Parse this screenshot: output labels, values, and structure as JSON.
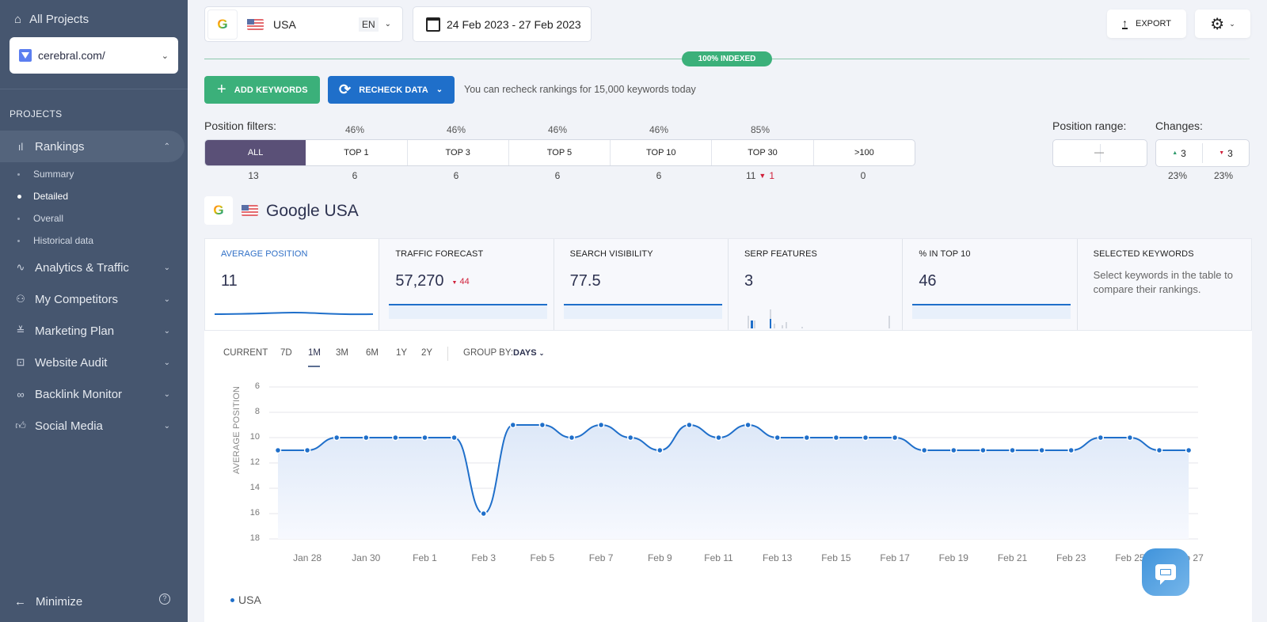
{
  "sidebar": {
    "all_projects": "All Projects",
    "project": "cerebral.com/",
    "section": "PROJECTS",
    "items": [
      {
        "label": "Rankings",
        "icon": "bar-chart-icon"
      },
      {
        "label": "Analytics & Traffic",
        "icon": "pulse-icon"
      },
      {
        "label": "My Competitors",
        "icon": "users-icon"
      },
      {
        "label": "Marketing Plan",
        "icon": "checklist-icon"
      },
      {
        "label": "Website Audit",
        "icon": "search-box-icon"
      },
      {
        "label": "Backlink Monitor",
        "icon": "link-icon"
      },
      {
        "label": "Social Media",
        "icon": "thumbs-up-icon"
      }
    ],
    "sub_items": [
      "Summary",
      "Detailed",
      "Overall",
      "Historical data"
    ],
    "minimize": "Minimize"
  },
  "header": {
    "search_engine": "G",
    "country": "USA",
    "language": "EN",
    "date_range": "24 Feb 2023 - 27 Feb 2023",
    "export": "EXPORT",
    "indexed": "100% INDEXED",
    "add_keywords": "ADD KEYWORDS",
    "recheck": "RECHECK DATA",
    "recheck_note": "You can recheck rankings for 15,000 keywords today"
  },
  "filters": {
    "label": "Position filters:",
    "segments": [
      {
        "label": "ALL",
        "pct": "",
        "count": "13"
      },
      {
        "label": "TOP 1",
        "pct": "46%",
        "count": "6"
      },
      {
        "label": "TOP 3",
        "pct": "46%",
        "count": "6"
      },
      {
        "label": "TOP 5",
        "pct": "46%",
        "count": "6"
      },
      {
        "label": "TOP 10",
        "pct": "46%",
        "count": "6"
      },
      {
        "label": "TOP 30",
        "pct": "85%",
        "count": "11",
        "change": "1"
      },
      {
        "label": ">100",
        "pct": "",
        "count": "0"
      }
    ],
    "range_label": "Position range:",
    "range_value": "—",
    "changes_label": "Changes:",
    "changes_up": "3",
    "changes_down": "3",
    "changes_up_pct": "23%",
    "changes_down_pct": "23%"
  },
  "engine_title": "Google USA",
  "tiles": [
    {
      "label": "AVERAGE POSITION",
      "value": "11"
    },
    {
      "label": "TRAFFIC FORECAST",
      "value": "57,270",
      "change": "44"
    },
    {
      "label": "SEARCH VISIBILITY",
      "value": "77.5"
    },
    {
      "label": "SERP FEATURES",
      "value": "3"
    },
    {
      "label": "% IN TOP 10",
      "value": "46"
    },
    {
      "label": "SELECTED KEYWORDS",
      "desc": "Select keywords in the table to compare their rankings."
    }
  ],
  "ranges": [
    "CURRENT",
    "7D",
    "1M",
    "3M",
    "6M",
    "1Y",
    "2Y"
  ],
  "active_range": "1M",
  "group_by_label": "GROUP BY:",
  "group_by_value": "DAYS",
  "legend": "USA",
  "colors": {
    "accent": "#1f6fca",
    "green": "#3bb07a",
    "purple": "#5a5077",
    "red": "#d0203a"
  },
  "chart_data": {
    "type": "line",
    "ylabel": "AVERAGE POSITION",
    "ylim": [
      6,
      18
    ],
    "y_inverted": true,
    "yticks": [
      6,
      8,
      10,
      12,
      14,
      16,
      18
    ],
    "xtick_labels": [
      "Jan 28",
      "Jan 30",
      "Feb 1",
      "Feb 3",
      "Feb 5",
      "Feb 7",
      "Feb 9",
      "Feb 11",
      "Feb 13",
      "Feb 15",
      "Feb 17",
      "Feb 19",
      "Feb 21",
      "Feb 23",
      "Feb 25",
      "Feb 27"
    ],
    "x": [
      "Jan 27",
      "Jan 28",
      "Jan 29",
      "Jan 30",
      "Jan 31",
      "Feb 1",
      "Feb 2",
      "Feb 3",
      "Feb 4",
      "Feb 5",
      "Feb 6",
      "Feb 7",
      "Feb 8",
      "Feb 9",
      "Feb 10",
      "Feb 11",
      "Feb 12",
      "Feb 13",
      "Feb 14",
      "Feb 15",
      "Feb 16",
      "Feb 17",
      "Feb 18",
      "Feb 19",
      "Feb 20",
      "Feb 21",
      "Feb 22",
      "Feb 23",
      "Feb 24",
      "Feb 25",
      "Feb 26",
      "Feb 27"
    ],
    "series": [
      {
        "name": "USA",
        "values": [
          11,
          11,
          10,
          10,
          10,
          10,
          10,
          16,
          9,
          9,
          10,
          9,
          10,
          11,
          9,
          10,
          9,
          10,
          10,
          10,
          10,
          10,
          11,
          11,
          11,
          11,
          11,
          11,
          10,
          10,
          11,
          11
        ]
      }
    ],
    "grid": true,
    "legend": "bottom-left"
  }
}
